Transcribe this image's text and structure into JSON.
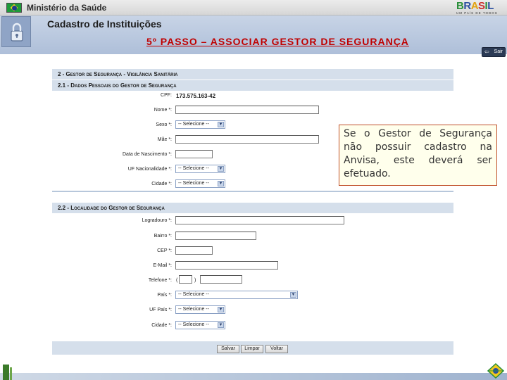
{
  "header": {
    "ministry": "Ministério da Saúde",
    "app_title": "Cadastro de Instituições",
    "step_title": "5º PASSO – ASSOCIAR GESTOR DE SEGURANÇA",
    "logout_label": "Sair",
    "gov_logo": {
      "wordmark": "BRASIL",
      "tagline": "UM PAÍS DE TODOS"
    }
  },
  "section1": {
    "heading": "2 - Gestor de Segurança - Vigilância Sanitária",
    "subheading": "2.1 - Dados Pessoais do Gestor de Segurança",
    "cpf_label": "CPF:",
    "cpf_value": "173.575.163-42",
    "fields": {
      "nome": "Nome *:",
      "sexo": "Sexo *:",
      "mae": "Mãe *:",
      "nascimento": "Data de Nascimento *:",
      "uf_nacionalidade": "UF Nacionalidade *:",
      "cidade": "Cidade *:"
    },
    "select_placeholder": "-- Selecione --"
  },
  "section2": {
    "heading": "2.2 - Localidade do Gestor de Segurança",
    "fields": {
      "logradouro": "Logradouro *:",
      "bairro": "Bairro *:",
      "cep": "CEP *:",
      "email": "E-Mail *:",
      "telefone": "Telefone *:",
      "pais": "País *:",
      "uf_pais": "UF País *:",
      "cidade": "Cidade *:"
    },
    "phone_open": "(",
    "phone_close": ")",
    "select_placeholder": "-- Selecione --"
  },
  "buttons": {
    "save": "Salvar",
    "clear": "Limpar",
    "back": "Voltar"
  },
  "callout": "Se o Gestor de Segurança não possuir cadastro na Anvisa, este deverá ser efetuado.",
  "colors": {
    "step_title": "#c00000",
    "header_blue": "#aebfd9",
    "section_bg": "#d5dfeb",
    "callout_border": "#c0502a",
    "callout_bg": "#ffffec"
  },
  "icons": [
    "brazil-flag-icon",
    "lock-icon",
    "logout-icon",
    "select-arrow-icon",
    "emblem-icon"
  ]
}
